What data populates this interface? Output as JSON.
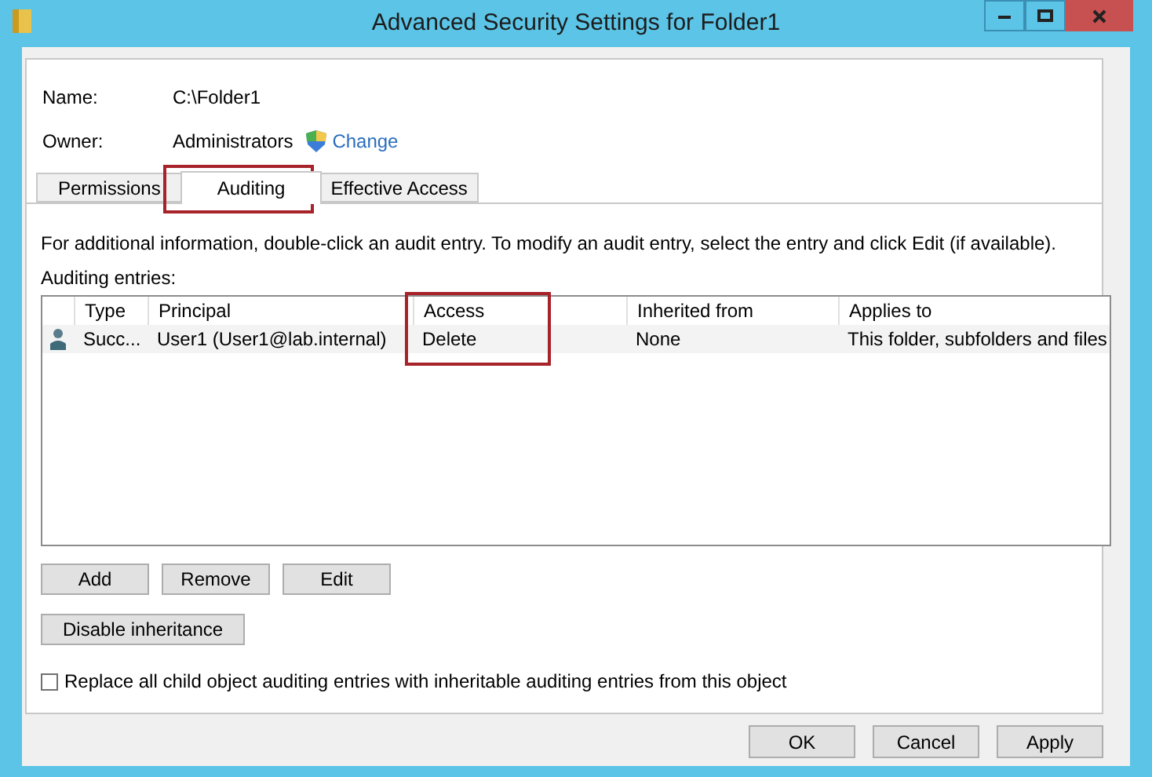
{
  "window": {
    "title": "Advanced Security Settings for Folder1"
  },
  "name": {
    "label": "Name:",
    "value": "C:\\Folder1"
  },
  "owner": {
    "label": "Owner:",
    "value": "Administrators",
    "link": "Change"
  },
  "tabs": [
    {
      "label": "Permissions",
      "selected": false
    },
    {
      "label": "Auditing",
      "selected": true
    },
    {
      "label": "Effective Access",
      "selected": false
    }
  ],
  "instructions": "For additional information, double-click an audit entry. To modify an audit entry, select the entry and click Edit (if available).",
  "entries_label": "Auditing entries:",
  "table": {
    "columns": [
      "Type",
      "Principal",
      "Access",
      "Inherited from",
      "Applies to"
    ],
    "rows": [
      {
        "cells": [
          "Succ...",
          "User1 (User1@lab.internal)",
          "Delete",
          "None",
          "This folder, subfolders and files"
        ]
      }
    ]
  },
  "entry_buttons": [
    "Add",
    "Remove",
    "Edit"
  ],
  "inheritance_button": "Disable inheritance",
  "replace_checkbox": {
    "label": "Replace all child object auditing entries with inheritable auditing entries from this object",
    "checked": false
  },
  "dialog_buttons": [
    "OK",
    "Cancel",
    "Apply"
  ]
}
